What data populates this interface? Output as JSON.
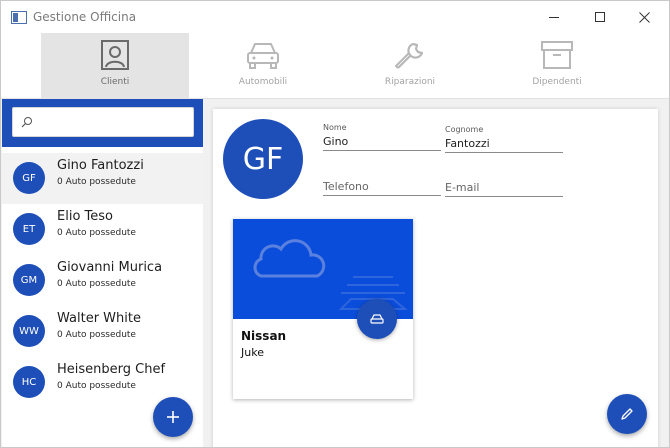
{
  "window": {
    "title": "Gestione Officina"
  },
  "nav": {
    "tabs": [
      {
        "label": "Clienti",
        "icon": "person-icon",
        "active": true
      },
      {
        "label": "Automobili",
        "icon": "car-icon",
        "active": false
      },
      {
        "label": "Riparazioni",
        "icon": "wrench-icon",
        "active": false
      },
      {
        "label": "Dipendenti",
        "icon": "archive-box-icon",
        "active": false
      }
    ]
  },
  "search": {
    "value": "",
    "placeholder": ""
  },
  "clients": [
    {
      "initials": "GF",
      "name": "Gino Fantozzi",
      "cars": "0 Auto possedute",
      "selected": true
    },
    {
      "initials": "ET",
      "name": "Elio Teso",
      "cars": "0 Auto possedute",
      "selected": false
    },
    {
      "initials": "GM",
      "name": "Giovanni Murica",
      "cars": "0 Auto possedute",
      "selected": false
    },
    {
      "initials": "WW",
      "name": "Walter White",
      "cars": "0 Auto possedute",
      "selected": false
    },
    {
      "initials": "HC",
      "name": "Heisenberg Chef",
      "cars": "0 Auto possedute",
      "selected": false
    }
  ],
  "detail": {
    "initials": "GF",
    "fields": {
      "nome": {
        "label": "Nome",
        "value": "Gino"
      },
      "cognome": {
        "label": "Cognome",
        "value": "Fantozzi"
      },
      "telefono": {
        "placeholder": "Telefono"
      },
      "email": {
        "placeholder": "E-mail"
      }
    },
    "cars": [
      {
        "make": "Nissan",
        "model": "Juke"
      }
    ]
  },
  "colors": {
    "accent": "#1e4fb8",
    "card_banner": "#0b4ddb"
  }
}
